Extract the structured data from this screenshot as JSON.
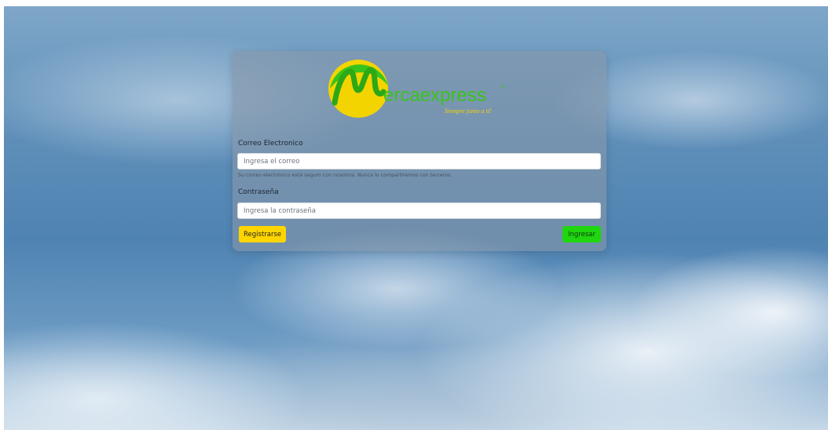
{
  "brand": {
    "logo_text": "ercaexpress",
    "tagline": "Siempre junto a ti!",
    "registered_mark": "®",
    "colors": {
      "green": "#39c41a",
      "yellow": "#f3d400"
    }
  },
  "form": {
    "email_label": "Correo Electronico",
    "email_placeholder": "Ingresa el correo",
    "email_help": "Su correo electrónico está seguro con nosotros. Nunca lo compartiremos con terceros.",
    "password_label": "Contraseña",
    "password_placeholder": "Ingresa la contraseña",
    "register_button": "Registrarse",
    "login_button": "Ingresar"
  }
}
